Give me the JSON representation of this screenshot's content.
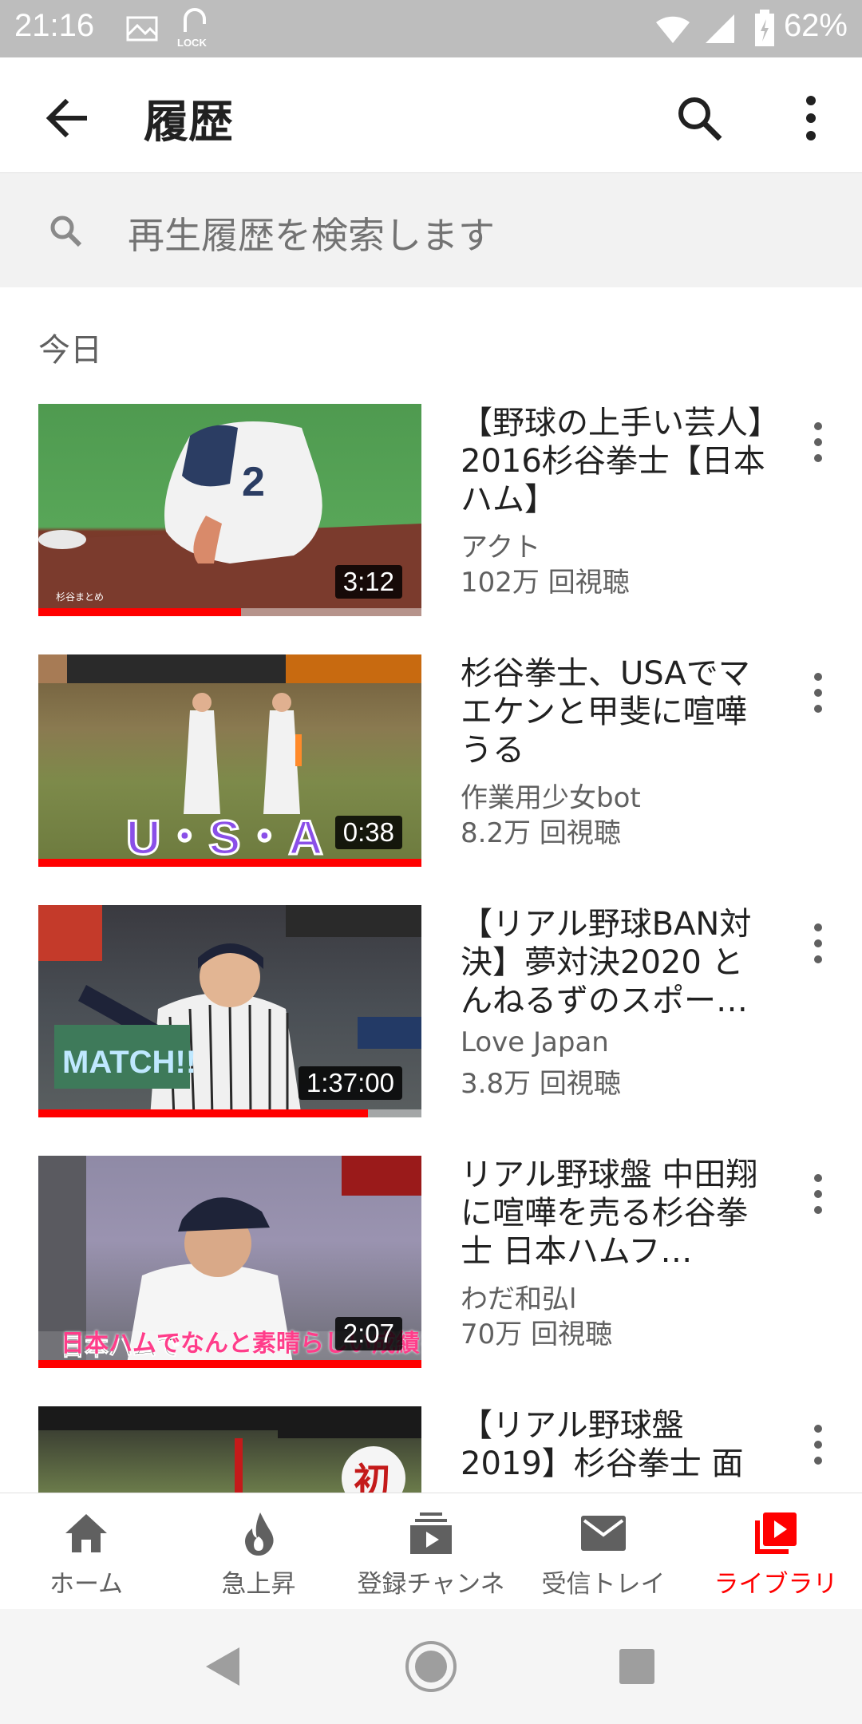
{
  "status_bar": {
    "time": "21:16",
    "battery": "62%",
    "lock_label": "LOCK"
  },
  "app_bar": {
    "title": "履歴"
  },
  "search": {
    "placeholder": "再生履歴を検索します"
  },
  "section": {
    "label": "今日"
  },
  "videos": [
    {
      "title": "【野球の上手い芸人】2016杉谷拳士【日本ハム】",
      "channel": "アクト",
      "views": "102万 回視聴",
      "duration": "3:12",
      "watched_fraction": 0.53,
      "thumb_caption": "杉谷まとめ"
    },
    {
      "title": "杉谷拳士、USAでマエケンと甲斐に喧嘩うる",
      "channel": "作業用少女bot",
      "views": "8.2万 回視聴",
      "duration": "0:38",
      "watched_fraction": 1.0,
      "thumb_caption": "U・S・A"
    },
    {
      "title": "【リアル野球BAN対決】夢対決2020 とんねるずのスポー…",
      "channel": "Love Japan",
      "views": "3.8万 回視聴",
      "duration": "1:37:00",
      "watched_fraction": 0.86,
      "thumb_caption": "MATCH!!"
    },
    {
      "title": "リアル野球盤 中田翔に喧嘩を売る杉谷拳士 日本ハムフ…",
      "channel": "わだ和弘l",
      "views": "70万 回視聴",
      "duration": "2:07",
      "watched_fraction": 1.0,
      "thumb_caption": "日本ハムでなんと素晴らしい成績を"
    },
    {
      "title": "【リアル野球盤2019】杉谷拳士 面",
      "channel": "",
      "views": "",
      "duration": "",
      "watched_fraction": 0,
      "thumb_caption": "初"
    }
  ],
  "bottom_nav": {
    "items": [
      {
        "label": "ホーム",
        "icon": "home-icon"
      },
      {
        "label": "急上昇",
        "icon": "trending-icon"
      },
      {
        "label": "登録チャンネル",
        "icon": "subscriptions-icon"
      },
      {
        "label": "受信トレイ",
        "icon": "inbox-icon"
      },
      {
        "label": "ライブラリ",
        "icon": "library-icon"
      }
    ],
    "active_index": 4
  },
  "colors": {
    "accent": "#ff0000",
    "status_bar_bg": "#bdbdbd",
    "search_bg": "#f2f2f2",
    "secondary_text": "#606060"
  }
}
